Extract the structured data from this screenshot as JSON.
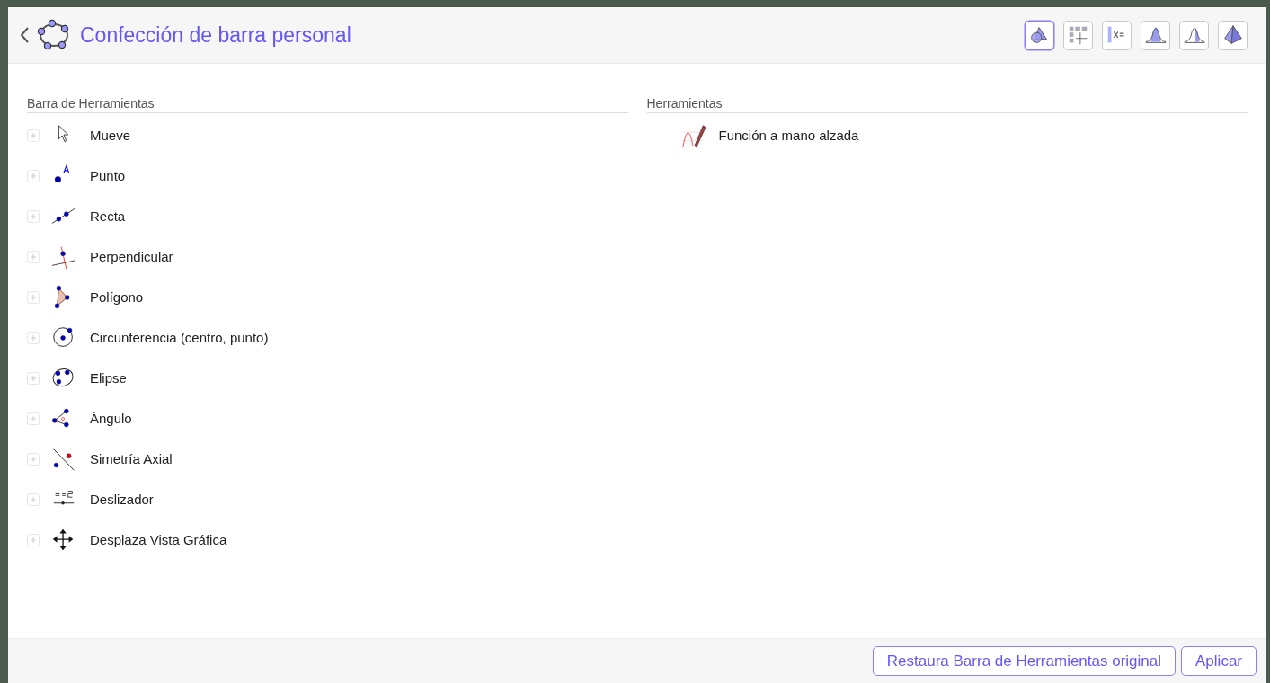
{
  "header": {
    "title": "Confección de barra personal"
  },
  "perspectives": [
    {
      "kind": "graphics",
      "selected": true
    },
    {
      "kind": "spreadsheet",
      "selected": false
    },
    {
      "kind": "algebra",
      "selected": false
    },
    {
      "kind": "probability",
      "selected": false
    },
    {
      "kind": "probability2",
      "selected": false
    },
    {
      "kind": "space",
      "selected": false
    }
  ],
  "toolbar_panel": {
    "heading": "Barra de Herramientas",
    "tools": [
      {
        "kind": "move",
        "label": "Mueve"
      },
      {
        "kind": "point",
        "label": "Punto"
      },
      {
        "kind": "line",
        "label": "Recta"
      },
      {
        "kind": "perpendicular",
        "label": "Perpendicular"
      },
      {
        "kind": "polygon",
        "label": "Polígono"
      },
      {
        "kind": "circle",
        "label": "Circunferencia (centro, punto)"
      },
      {
        "kind": "ellipse",
        "label": "Elipse"
      },
      {
        "kind": "angle",
        "label": "Ángulo"
      },
      {
        "kind": "reflect",
        "label": "Simetría Axial"
      },
      {
        "kind": "slider",
        "label": "Deslizador"
      },
      {
        "kind": "move_view",
        "label": "Desplaza Vista Gráfica"
      }
    ]
  },
  "tools_panel": {
    "heading": "Herramientas",
    "tools": [
      {
        "kind": "freehand",
        "label": "Función a mano alzada"
      }
    ]
  },
  "buttons": [
    "Restaura Barra de Herramientas original",
    "Aplicar"
  ]
}
